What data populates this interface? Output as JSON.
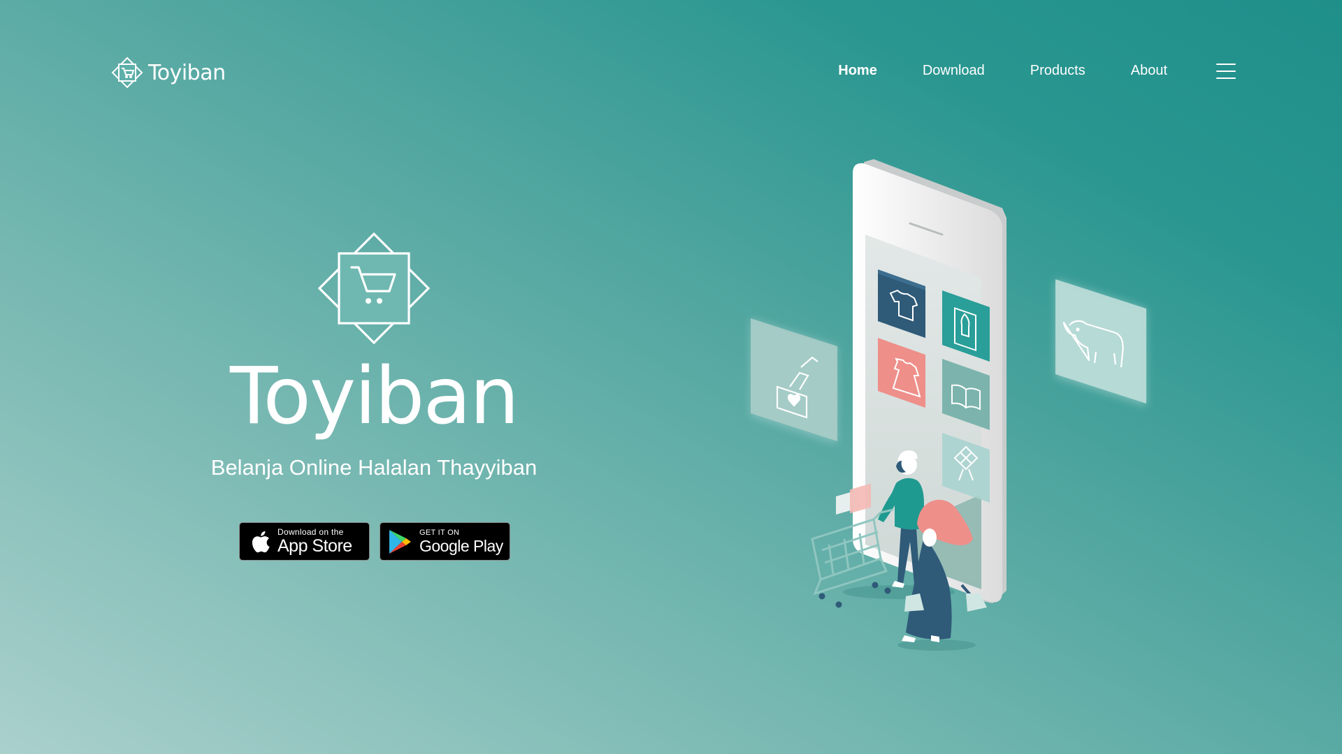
{
  "brand": {
    "name": "Toyiban",
    "icon": "cart-diamond-logo-icon"
  },
  "nav": {
    "items": [
      {
        "label": "Home",
        "active": true
      },
      {
        "label": "Download",
        "active": false
      },
      {
        "label": "Products",
        "active": false
      },
      {
        "label": "About",
        "active": false
      }
    ],
    "menu_icon": "hamburger-menu-icon"
  },
  "hero": {
    "title": "Toyiban",
    "subtitle": "Belanja Online Halalan Thayyiban",
    "logo_icon": "cart-diamond-logo-icon"
  },
  "stores": {
    "apple": {
      "small": "Download on the",
      "big": "App Store",
      "icon": "apple-icon"
    },
    "google": {
      "small": "GET IT ON",
      "big": "Google Play",
      "icon": "google-play-icon"
    }
  },
  "illustration": {
    "tiles": [
      "shirt-icon",
      "prayer-mat-icon",
      "dress-icon",
      "quran-icon",
      "ketupat-icon",
      "donation-icon",
      "cow-icon"
    ],
    "colors": {
      "navy": "#2f5a78",
      "teal": "#2a9e98",
      "coral": "#ee8f8a",
      "mint": "#7cb4ad"
    }
  },
  "colors": {
    "gradient_start": "#aad0cc",
    "gradient_end": "#1f8f8a",
    "text": "#ffffff"
  }
}
